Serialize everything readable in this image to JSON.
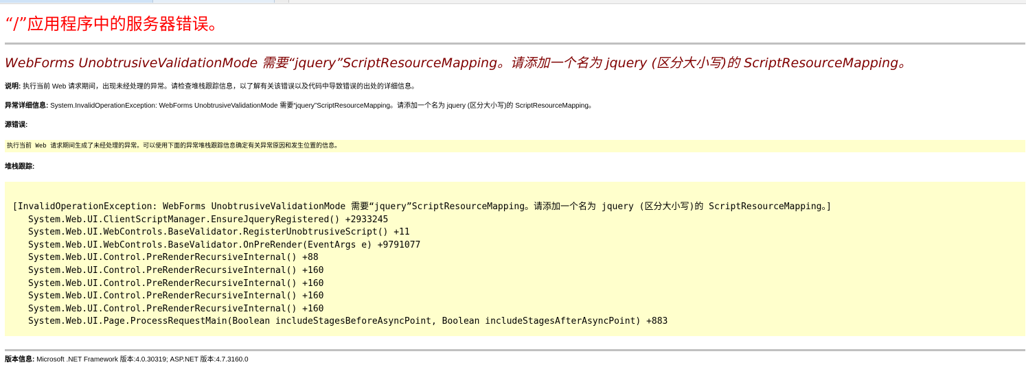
{
  "app_title": "“/”应用程序中的服务器错误。",
  "error_heading": "WebForms UnobtrusiveValidationMode 需要“jquery”ScriptResourceMapping。请添加一个名为 jquery (区分大小写)的 ScriptResourceMapping。",
  "description": {
    "label": "说明:",
    "text": " 执行当前 Web 请求期间，出现未经处理的异常。请检查堆栈跟踪信息，以了解有关该错误以及代码中导致错误的出处的详细信息。"
  },
  "exception_details": {
    "label": "异常详细信息:",
    "text": " System.InvalidOperationException: WebForms UnobtrusiveValidationMode 需要“jquery”ScriptResourceMapping。请添加一个名为 jquery (区分大小写)的 ScriptResourceMapping。"
  },
  "source_error": {
    "label": "源错误:",
    "text": "执行当前 Web 请求期间生成了未经处理的异常。可以使用下面的异常堆栈跟踪信息确定有关异常原因和发生位置的信息。"
  },
  "stack_trace": {
    "label": "堆栈跟踪:",
    "lines": [
      "[InvalidOperationException: WebForms UnobtrusiveValidationMode 需要“jquery”ScriptResourceMapping。请添加一个名为 jquery (区分大小写)的 ScriptResourceMapping。]",
      "System.Web.UI.ClientScriptManager.EnsureJqueryRegistered() +2933245",
      "System.Web.UI.WebControls.BaseValidator.RegisterUnobtrusiveScript() +11",
      "System.Web.UI.WebControls.BaseValidator.OnPreRender(EventArgs e) +9791077",
      "System.Web.UI.Control.PreRenderRecursiveInternal() +88",
      "System.Web.UI.Control.PreRenderRecursiveInternal() +160",
      "System.Web.UI.Control.PreRenderRecursiveInternal() +160",
      "System.Web.UI.Control.PreRenderRecursiveInternal() +160",
      "System.Web.UI.Control.PreRenderRecursiveInternal() +160",
      "System.Web.UI.Page.ProcessRequestMain(Boolean includeStagesBeforeAsyncPoint, Boolean includeStagesAfterAsyncPoint) +883"
    ]
  },
  "version_info": {
    "label": "版本信息:",
    "text": " Microsoft .NET Framework 版本:4.0.30319; ASP.NET 版本:4.7.3160.0"
  },
  "colors": {
    "title_red": "#ff0000",
    "heading_maroon": "#800000",
    "code_background": "#ffffcc",
    "rule_gray": "#c0c0c0"
  }
}
